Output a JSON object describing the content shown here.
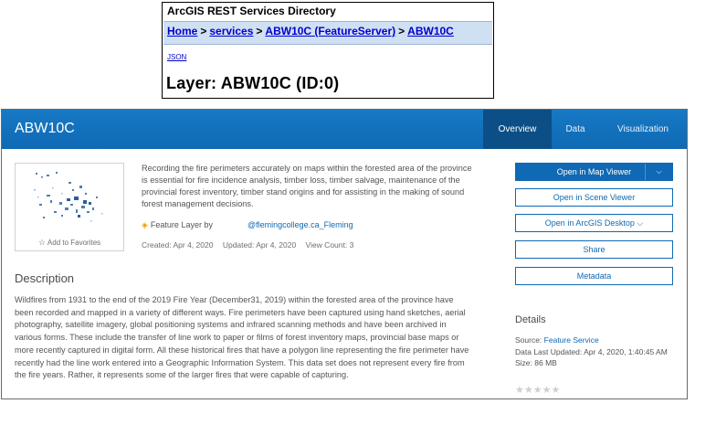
{
  "rest": {
    "title": "ArcGIS REST Services Directory",
    "breadcrumb": [
      "Home",
      "services",
      "ABW10C (FeatureServer)",
      "ABW10C"
    ],
    "separator": ">",
    "json_link": "JSON",
    "layer_title": "Layer: ABW10C (ID:0)"
  },
  "hub": {
    "title": "ABW10C",
    "tabs": [
      "Overview",
      "Data",
      "Visualization"
    ],
    "favorites_label": "Add to Favorites",
    "summary": "Recording the fire perimeters accurately on maps within the forested area of the province is essential for fire incidence analysis, timber loss, timber salvage, maintenance of the provincial forest inventory, timber stand origins and for assisting in the making of sound forest management decisions.",
    "item_type": "Feature Layer by",
    "owner": "@flemingcollege.ca_Fleming",
    "created": "Created: Apr 4, 2020",
    "updated": "Updated: Apr 4, 2020",
    "views": "View Count: 3",
    "description_heading": "Description",
    "description": "Wildfires from 1931 to the end of the 2019 Fire Year (December31, 2019) within the forested area of the province have been recorded and mapped in a variety of different ways. Fire perimeters have been captured using hand sketches, aerial photography, satellite imagery, global positioning systems and infrared scanning methods and have been archived in various forms. These include the transfer of line work to paper or films of forest inventory maps, provincial base maps or more recently captured in digital form. All these historical fires that have a polygon line representing the fire perimeter have recently had the line work entered into a Geographic Information System. This data set does not represent every fire from the fire years. Rather, it represents some of the larger fires that were capable of capturing.",
    "buttons": {
      "map_viewer": "Open in Map Viewer",
      "scene_viewer": "Open in Scene Viewer",
      "desktop": "Open in ArcGIS Desktop",
      "share": "Share",
      "metadata": "Metadata"
    },
    "details": {
      "heading": "Details",
      "source_label": "Source:",
      "source_value": "Feature Service",
      "last_updated": "Data Last Updated: Apr 4, 2020, 1:40:45 AM",
      "size": "Size: 86 MB",
      "rating": 0
    },
    "colors": {
      "header_blue": "#0f69b4",
      "active_tab": "#0c4f86",
      "link_blue": "#0f69b4"
    }
  }
}
